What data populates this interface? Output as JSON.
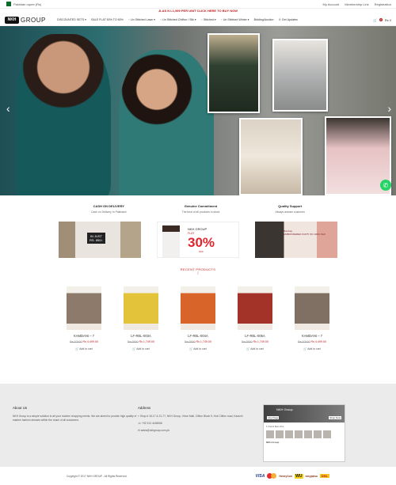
{
  "topbar": {
    "country": "Pakistan rupee (Rs)",
    "links": [
      "My Account",
      "Membership Link",
      "Registration"
    ]
  },
  "promo": "JLAS N L1,999 PER UNIT CLICK HERE TO BUY NOW",
  "logo": {
    "mark": "NKH",
    "word": "GROUP"
  },
  "nav": {
    "items": [
      "DISCOUNTED SETS ▾",
      "SALE FLAT 50% TO 60%",
      "Un Stitched Lawn ▾",
      "Un Stitched Chiffon / Silk ▾",
      "Stitched ▾",
      "Un Stitched Winter ▾",
      "Bidding/Auction",
      "Get Updates"
    ],
    "cart_count": "0",
    "cart_total": "Rs 0"
  },
  "features": [
    {
      "title": "CASH ON DELIVERY",
      "text": "Cash on Delivery In Pakistan!"
    },
    {
      "title": "Genuine Commitment",
      "text": "The best of all products in stock"
    },
    {
      "title": "Quality Support",
      "text": "Always answer customer"
    }
  ],
  "banners": {
    "b1_line1": "IN JUST",
    "b1_line2": "RS. 850/-",
    "b2_logo": "NKH GROUP",
    "b2_flat": "FLAT",
    "b2_pct": "30%",
    "b2_off": "OFF",
    "b3_title": "Bombay",
    "b3_text": "EMBROIDERED KURTI ON 100% SILK"
  },
  "recent": {
    "title": "RECENT PRODUCTS",
    "sep": "⁞"
  },
  "products": [
    {
      "name": "KAMDANI – 7",
      "old": "Rs 10000",
      "new": "Rs 4,499.00",
      "add": "Add to cart",
      "color": "#8d7a6a"
    },
    {
      "name": "LF-REL-003A",
      "old": "Rs 3500",
      "new": "Rs 1,749.00",
      "add": "Add to cart",
      "color": "#e3c33a"
    },
    {
      "name": "LF-REL-004A",
      "old": "Rs 3500",
      "new": "Rs 1,749.00",
      "add": "Add to cart",
      "color": "#d9642a"
    },
    {
      "name": "LF-REL-005A",
      "old": "Rs 3500",
      "new": "Rs 1,749.00",
      "add": "Add to cart",
      "color": "#a33228"
    },
    {
      "name": "KAMDANI – 7",
      "old": "Rs 10000",
      "new": "Rs 4,499.00",
      "add": "Add to cart",
      "color": "#7f7063"
    }
  ],
  "footer": {
    "about_title": "About Us",
    "about_text": "NKH Group is a simple solution to all your modern shopping needs. We are aimed to provide high quality of eastern fashion dresses within the reach of all customers.",
    "address_title": "Address",
    "address": "Shop # 16-17 & 21-77, NKH Group, Vince Mall, Clifton Block 9, Hub Clifton road, Karachi",
    "phone": "+92 313 4168066",
    "email": "sales@nkhgroup.com.pk",
    "fb_name": "NKH Group",
    "fb_like": "Like Page",
    "fb_shop": "Shop Now",
    "fb_liked": "1 friend likes this",
    "fb_page": "NKH Group"
  },
  "copyright": "Copyright © 2017 NKH GROUP - All Rights Reserved.",
  "payments": [
    "VISA",
    "HoneyCom",
    "WU",
    "easypaisa",
    "DHL"
  ]
}
